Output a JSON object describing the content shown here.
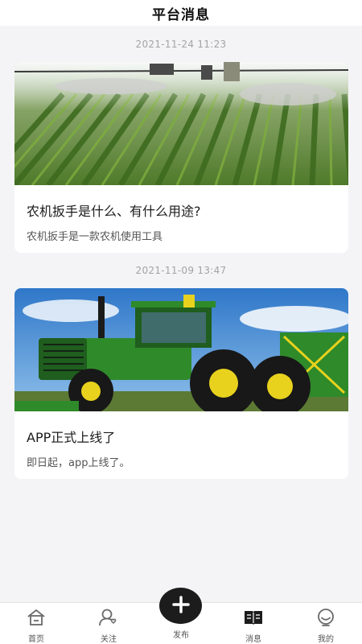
{
  "header": {
    "title": "平台消息"
  },
  "messages": [
    {
      "timestamp": "2021-11-24 11:23",
      "title": "农机扳手是什么、有什么用途?",
      "subtitle": "农机扳手是一款农机使用工具",
      "image": "crop-field-sprayer-photo"
    },
    {
      "timestamp": "2021-11-09 13:47",
      "title": "APP正式上线了",
      "subtitle": "即日起，app上线了。",
      "image": "green-tractor-photo"
    }
  ],
  "tabbar": {
    "items": [
      {
        "label": "首页",
        "icon": "home-icon"
      },
      {
        "label": "关注",
        "icon": "follow-user-icon"
      },
      {
        "label": "发布",
        "icon": "plus-icon"
      },
      {
        "label": "消息",
        "icon": "book-message-icon"
      },
      {
        "label": "我的",
        "icon": "profile-icon"
      }
    ],
    "active": "消息"
  }
}
